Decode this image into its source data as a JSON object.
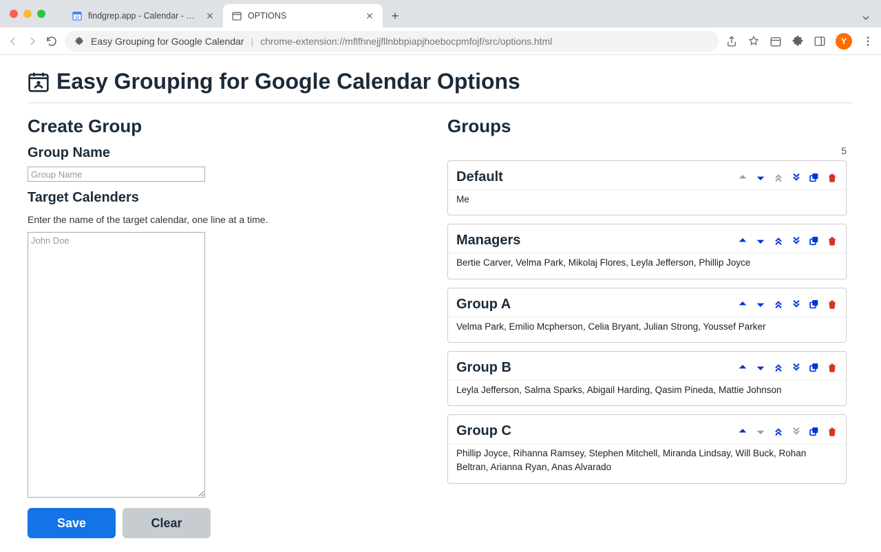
{
  "browser": {
    "tabs": [
      {
        "title": "findgrep.app - Calendar - Wee"
      },
      {
        "title": "OPTIONS"
      }
    ],
    "ext_name": "Easy Grouping for Google Calendar",
    "url": "chrome-extension://mflfhnejjfllnbbpiapjhoebocpmfojf/src/options.html",
    "avatar_letter": "Y"
  },
  "page": {
    "title": "Easy Grouping for Google Calendar Options",
    "create_heading": "Create Group",
    "group_name_label": "Group Name",
    "group_name_placeholder": "Group Name",
    "target_label": "Target Calenders",
    "target_hint": "Enter the name of the target calendar, one line at a time.",
    "target_placeholder": "John Doe",
    "save_label": "Save",
    "clear_label": "Clear",
    "groups_heading": "Groups",
    "groups_count": "5"
  },
  "groups": [
    {
      "name": "Default",
      "members": "Me",
      "up_disabled": true,
      "down_disabled": false,
      "top_disabled": true,
      "bottom_disabled": false
    },
    {
      "name": "Managers",
      "members": "Bertie Carver, Velma Park, Mikolaj Flores, Leyla Jefferson, Phillip Joyce",
      "up_disabled": false,
      "down_disabled": false,
      "top_disabled": false,
      "bottom_disabled": false
    },
    {
      "name": "Group A",
      "members": "Velma Park, Emilio Mcpherson, Celia Bryant, Julian Strong, Youssef Parker",
      "up_disabled": false,
      "down_disabled": false,
      "top_disabled": false,
      "bottom_disabled": false
    },
    {
      "name": "Group B",
      "members": "Leyla Jefferson, Salma Sparks, Abigail Harding, Qasim Pineda, Mattie Johnson",
      "up_disabled": false,
      "down_disabled": false,
      "top_disabled": false,
      "bottom_disabled": false
    },
    {
      "name": "Group C",
      "members": "Phillip Joyce, Rihanna Ramsey, Stephen Mitchell, Miranda Lindsay, Will Buck, Rohan Beltran, Arianna Ryan, Anas Alvarado",
      "up_disabled": false,
      "down_disabled": true,
      "top_disabled": false,
      "bottom_disabled": true
    }
  ]
}
